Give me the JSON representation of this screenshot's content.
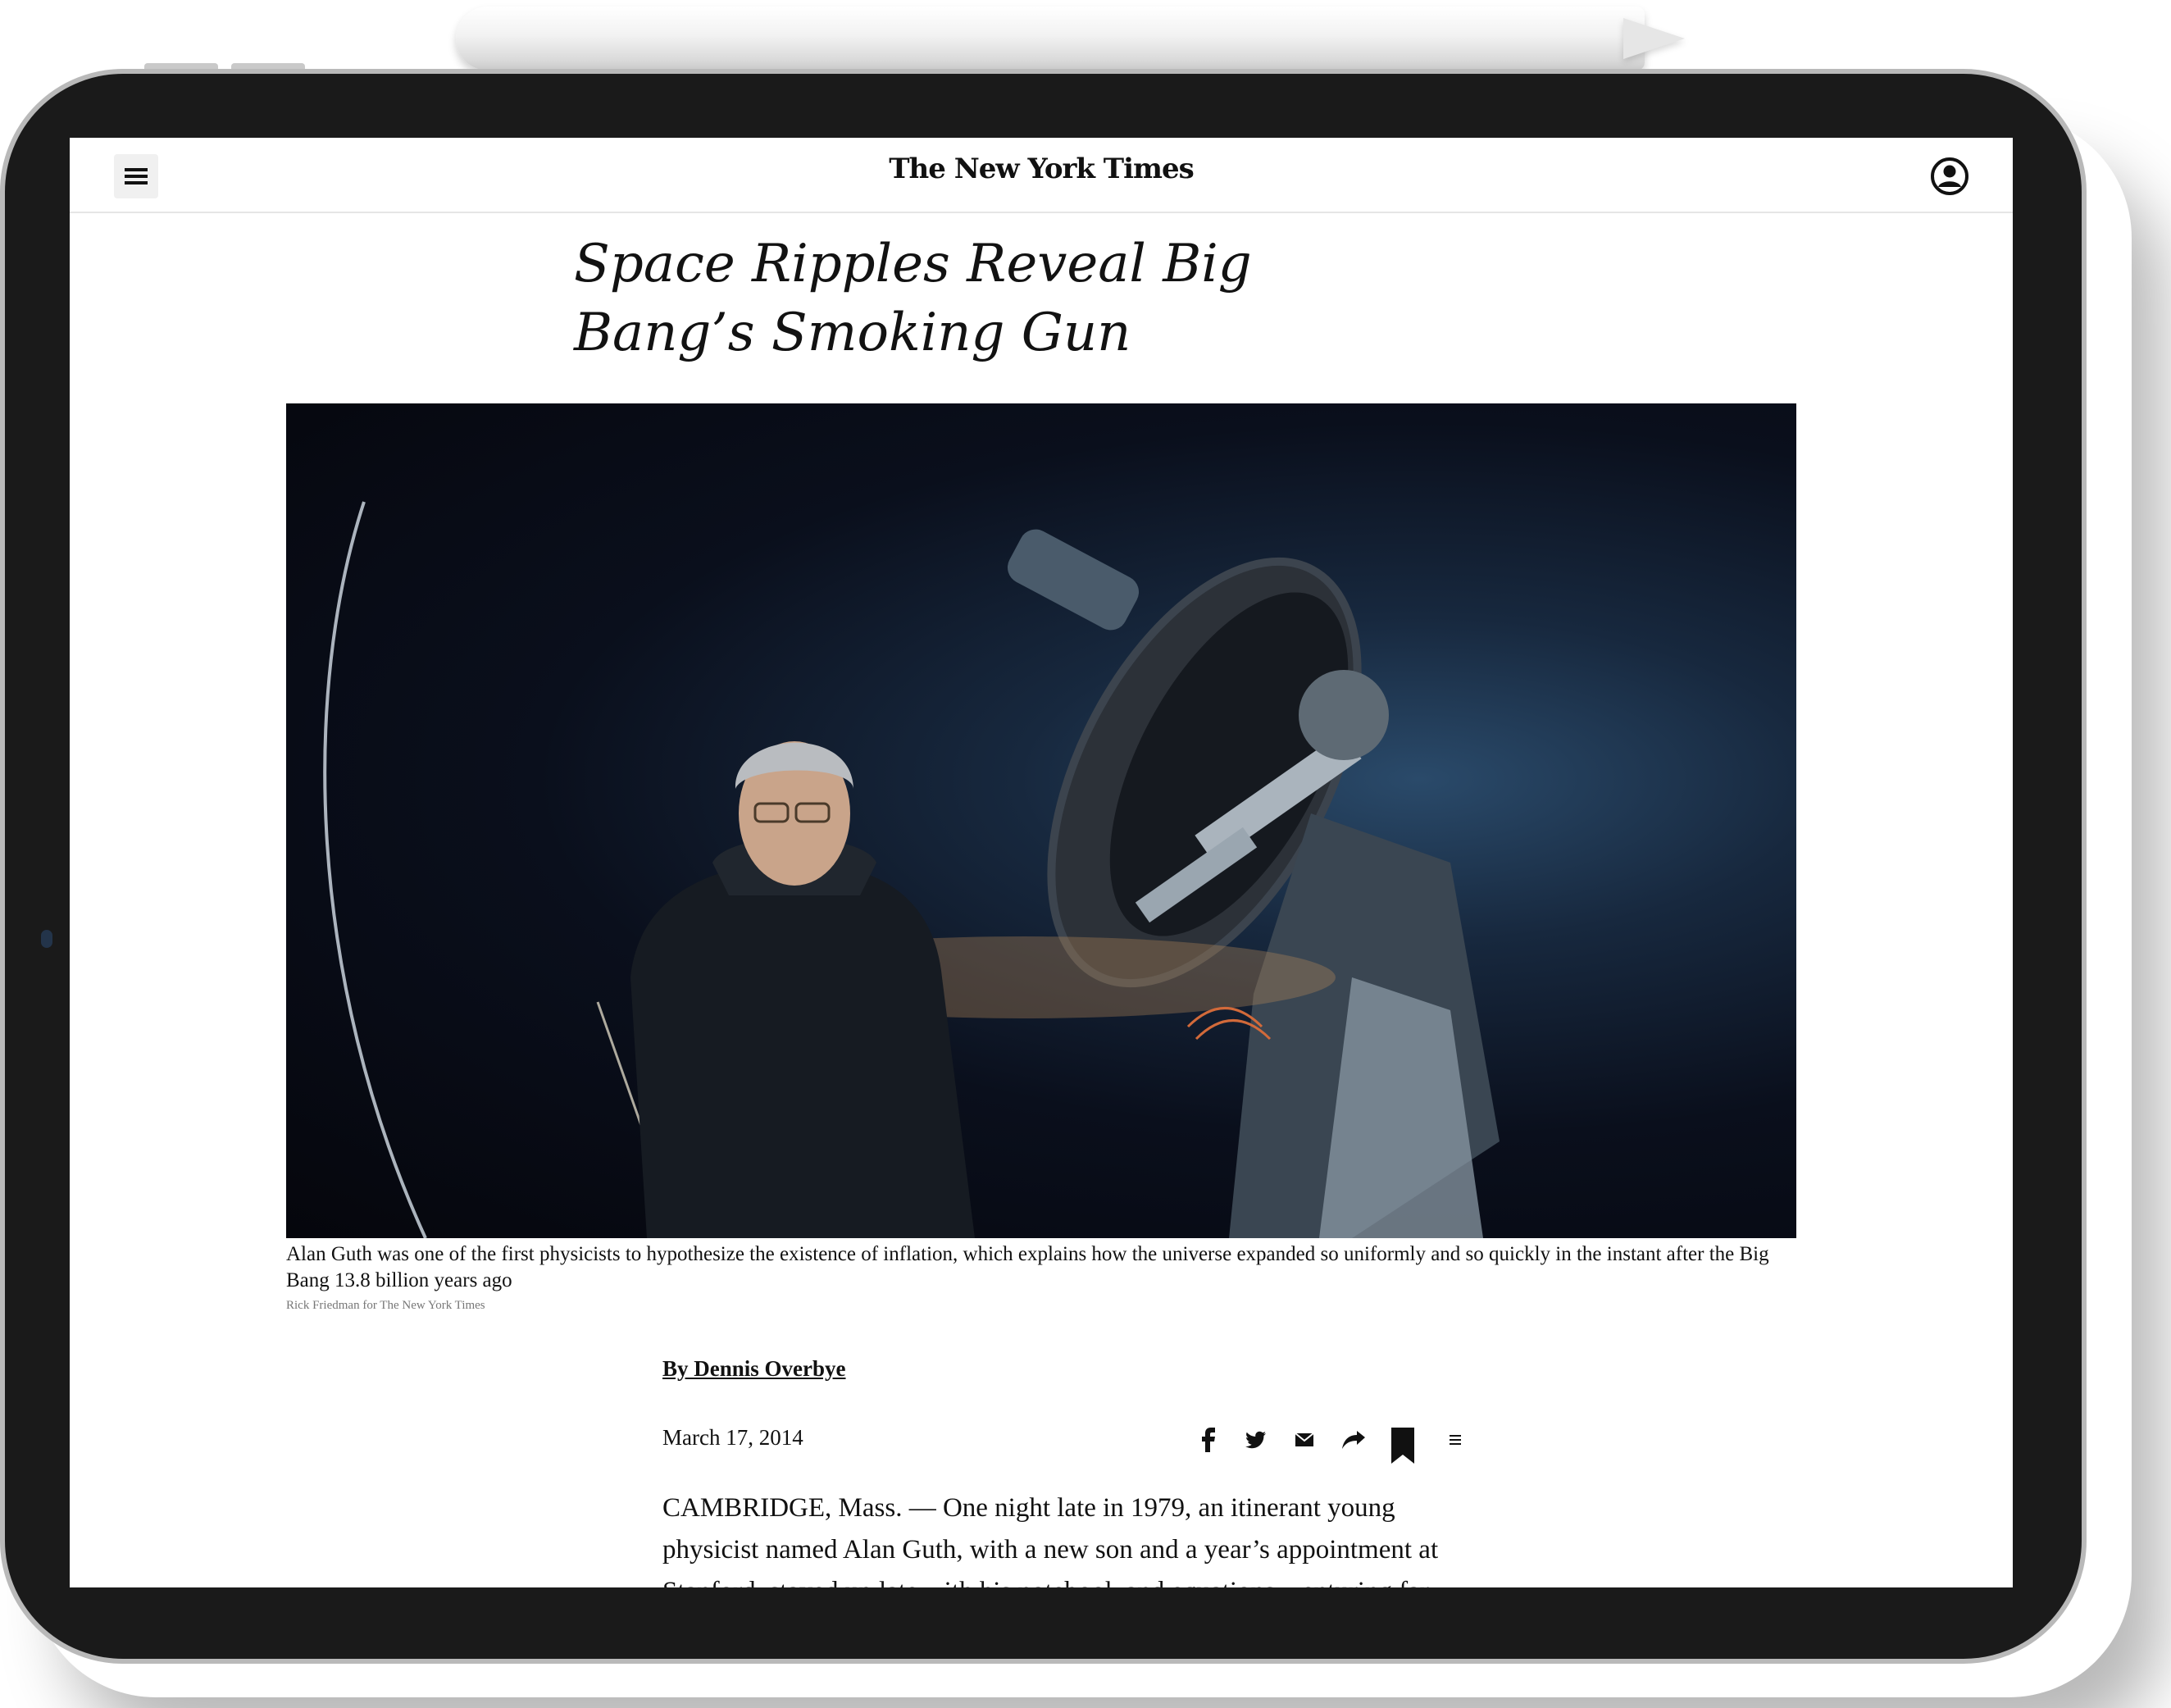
{
  "site": {
    "logo_text": "The New York Times"
  },
  "article": {
    "headline": "Space Ripples Reveal Big Bang’s Smoking Gun",
    "image_caption": "Alan Guth was one of the first physicists to hypothesize the existence of inflation, which explains how the universe expanded so uniformly and so quickly in the instant after the Big Bang 13.8 billion years ago",
    "image_credit": "Rick Friedman for The New York Times",
    "byline": "By Dennis Overbye",
    "date": "March 17, 2014",
    "body_lines": [
      "CAMBRIDGE, Mass. — One night late in 1979, an itinerant young",
      "physicist named Alan Guth, with a new son and a year’s appointment at",
      "Stanford, stayed up late with his notebook and equations, venturing far"
    ]
  },
  "icons": {
    "menu": "hamburger-menu-icon",
    "user": "user-account-icon",
    "share": [
      "facebook-icon",
      "twitter-icon",
      "email-icon",
      "share-arrow-icon",
      "bookmark-icon",
      "more-icon"
    ]
  },
  "colors": {
    "device_bezel": "#1a1a1a",
    "device_frame": "#b9b9b9",
    "text": "#111111",
    "photo_background": "#05060c"
  }
}
